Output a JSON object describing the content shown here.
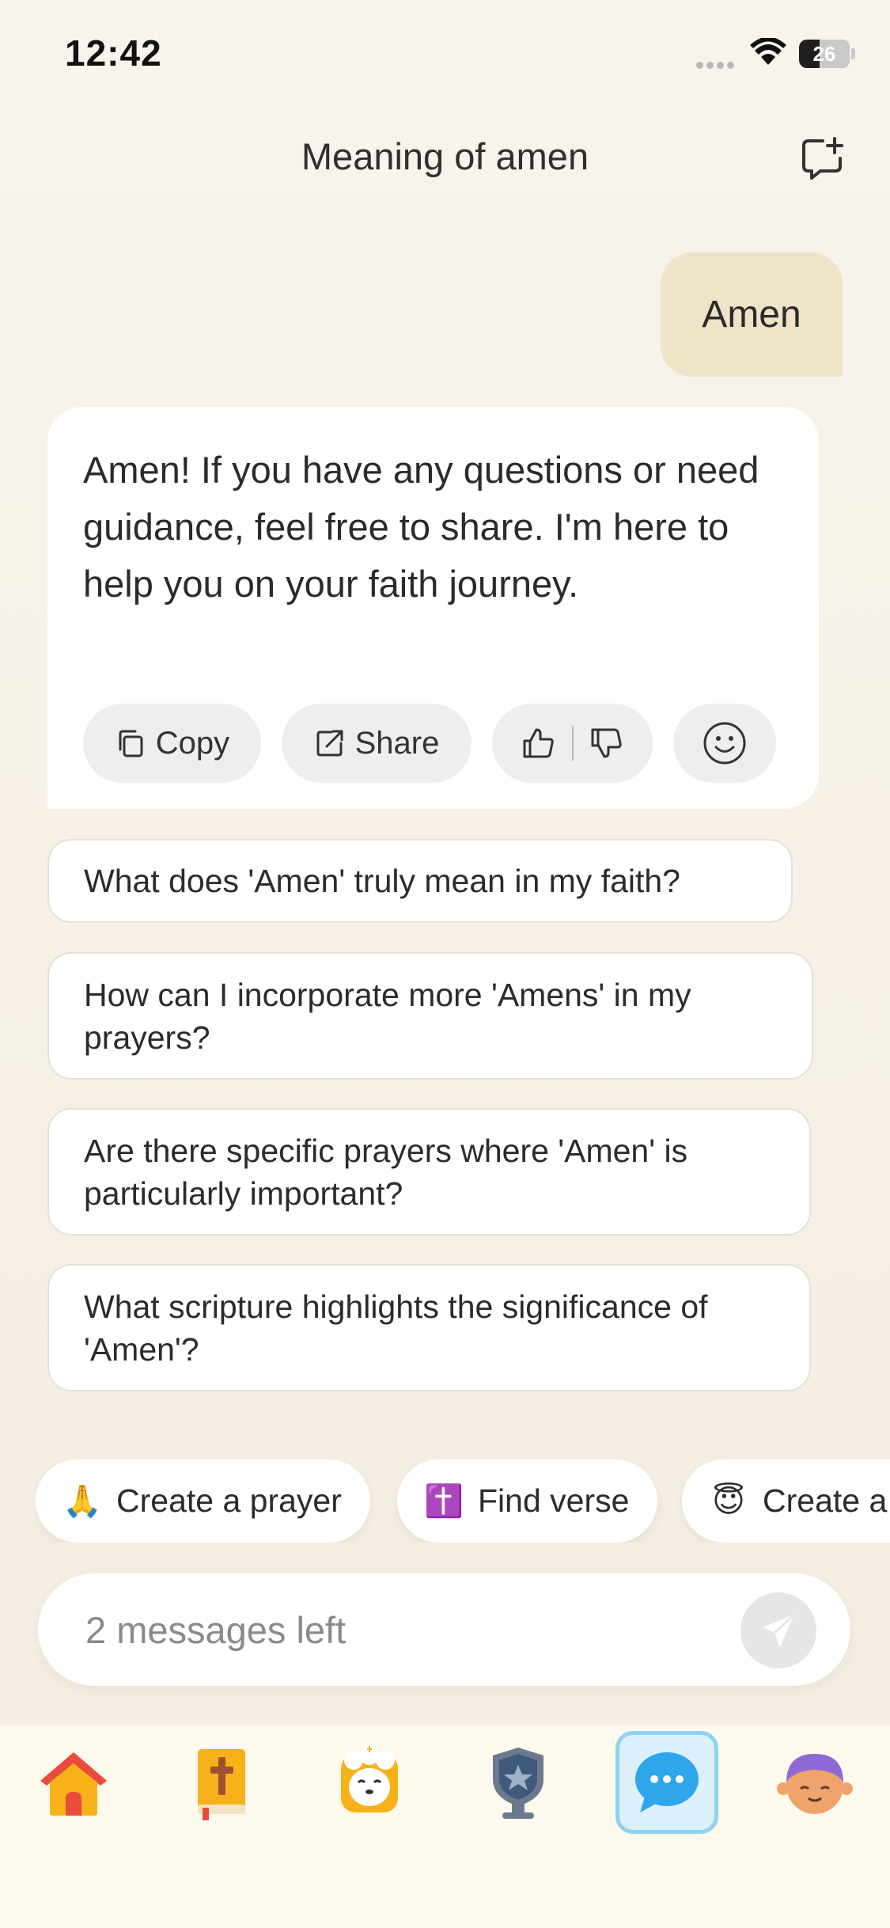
{
  "status_bar": {
    "time": "12:42",
    "battery": "26"
  },
  "header": {
    "title": "Meaning of amen"
  },
  "conversation": {
    "user_message": "Amen",
    "assistant_message": "Amen! If you have any questions or need guidance, feel free to share. I'm here to help you on your faith journey.",
    "actions": {
      "copy_label": "Copy",
      "share_label": "Share"
    }
  },
  "suggestions": [
    "What does 'Amen' truly mean in my faith?",
    "How can I incorporate more 'Amens' in my prayers?",
    "Are there specific prayers where 'Amen' is particularly important?",
    "What scripture highlights the significance of 'Amen'?"
  ],
  "quick_actions": [
    {
      "emoji": "🙏",
      "label": "Create a prayer"
    },
    {
      "emoji": "✝️",
      "label": "Find verse"
    },
    {
      "emoji": "😇",
      "label": "Create a"
    }
  ],
  "composer": {
    "placeholder": "2 messages left",
    "value": ""
  },
  "bottom_nav": {
    "items": [
      {
        "icon": "home-icon",
        "active": false
      },
      {
        "icon": "bible-icon",
        "active": false
      },
      {
        "icon": "lamb-mascot-icon",
        "active": false
      },
      {
        "icon": "shield-badge-icon",
        "active": false
      },
      {
        "icon": "chat-bubble-icon",
        "active": true
      },
      {
        "icon": "profile-avatar-icon",
        "active": false
      }
    ]
  },
  "colors": {
    "background": "#f8f4ec",
    "user_bubble": "#efe4c8",
    "active_tab_bg": "#dcf1fb",
    "active_tab_border": "#8fd3f2",
    "chat_icon": "#2fa5ec"
  }
}
